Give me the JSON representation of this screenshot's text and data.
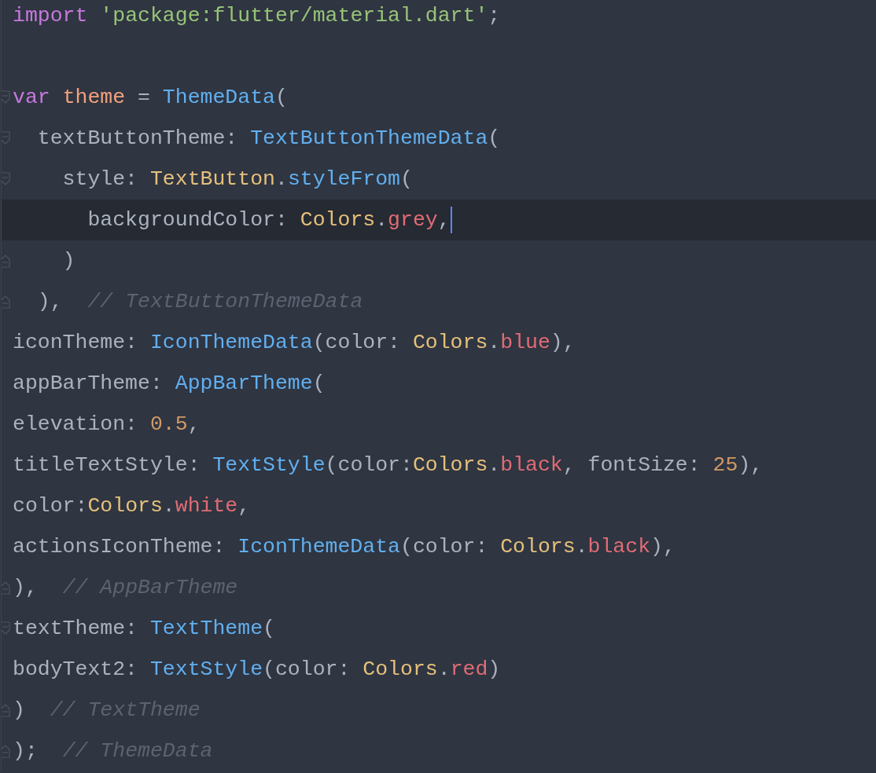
{
  "editor": {
    "lines": [
      {
        "current": false,
        "tokens": [
          {
            "kind": "keyword",
            "text": "import "
          },
          {
            "kind": "string",
            "text": "'package:flutter/material.dart'"
          },
          {
            "kind": "plain",
            "text": ";"
          }
        ]
      },
      {
        "current": false
      },
      {
        "current": false,
        "fold_opens": true,
        "tokens": [
          {
            "kind": "keyword",
            "text": "var "
          },
          {
            "kind": "variable",
            "text": "theme"
          },
          {
            "kind": "plain",
            "text": " = "
          },
          {
            "kind": "class",
            "text": "ThemeData"
          },
          {
            "kind": "plain",
            "text": "("
          }
        ]
      },
      {
        "current": false,
        "fold_opens": true,
        "tokens": [
          {
            "kind": "plain",
            "text": "  textButtonTheme: "
          },
          {
            "kind": "class",
            "text": "TextButtonThemeData"
          },
          {
            "kind": "plain",
            "text": "("
          }
        ]
      },
      {
        "current": false,
        "fold_opens": true,
        "tokens": [
          {
            "kind": "plain",
            "text": "    style: "
          },
          {
            "kind": "type",
            "text": "TextButton"
          },
          {
            "kind": "plain",
            "text": "."
          },
          {
            "kind": "class",
            "text": "styleFrom"
          },
          {
            "kind": "plain",
            "text": "("
          }
        ]
      },
      {
        "current": true,
        "caret": true,
        "tokens": [
          {
            "kind": "plain",
            "text": "      backgroundColor: "
          },
          {
            "kind": "type",
            "text": "Colors"
          },
          {
            "kind": "plain",
            "text": "."
          },
          {
            "kind": "constant",
            "text": "grey"
          },
          {
            "kind": "plain",
            "text": ","
          }
        ]
      },
      {
        "current": false,
        "fold_closes": true,
        "tokens": [
          {
            "kind": "plain",
            "text": "    )"
          }
        ]
      },
      {
        "current": false,
        "fold_closes": true,
        "tokens": [
          {
            "kind": "plain",
            "text": "  ),  "
          },
          {
            "kind": "comment",
            "text": "// TextButtonThemeData"
          }
        ]
      },
      {
        "current": false,
        "tokens": [
          {
            "kind": "plain",
            "text": "iconTheme: "
          },
          {
            "kind": "class",
            "text": "IconThemeData"
          },
          {
            "kind": "plain",
            "text": "(color: "
          },
          {
            "kind": "type",
            "text": "Colors"
          },
          {
            "kind": "plain",
            "text": "."
          },
          {
            "kind": "constant",
            "text": "blue"
          },
          {
            "kind": "plain",
            "text": "),"
          }
        ]
      },
      {
        "current": false,
        "tokens": [
          {
            "kind": "plain",
            "text": "appBarTheme: "
          },
          {
            "kind": "class",
            "text": "AppBarTheme"
          },
          {
            "kind": "plain",
            "text": "("
          }
        ]
      },
      {
        "current": false,
        "tokens": [
          {
            "kind": "plain",
            "text": "elevation: "
          },
          {
            "kind": "number",
            "text": "0.5"
          },
          {
            "kind": "plain",
            "text": ","
          }
        ]
      },
      {
        "current": false,
        "tokens": [
          {
            "kind": "plain",
            "text": "titleTextStyle: "
          },
          {
            "kind": "class",
            "text": "TextStyle"
          },
          {
            "kind": "plain",
            "text": "(color:"
          },
          {
            "kind": "type",
            "text": "Colors"
          },
          {
            "kind": "plain",
            "text": "."
          },
          {
            "kind": "constant",
            "text": "black"
          },
          {
            "kind": "plain",
            "text": ", fontSize: "
          },
          {
            "kind": "number",
            "text": "25"
          },
          {
            "kind": "plain",
            "text": "),"
          }
        ]
      },
      {
        "current": false,
        "tokens": [
          {
            "kind": "plain",
            "text": "color:"
          },
          {
            "kind": "type",
            "text": "Colors"
          },
          {
            "kind": "plain",
            "text": "."
          },
          {
            "kind": "constant",
            "text": "white"
          },
          {
            "kind": "plain",
            "text": ","
          }
        ]
      },
      {
        "current": false,
        "tokens": [
          {
            "kind": "plain",
            "text": "actionsIconTheme: "
          },
          {
            "kind": "class",
            "text": "IconThemeData"
          },
          {
            "kind": "plain",
            "text": "(color: "
          },
          {
            "kind": "type",
            "text": "Colors"
          },
          {
            "kind": "plain",
            "text": "."
          },
          {
            "kind": "constant",
            "text": "black"
          },
          {
            "kind": "plain",
            "text": "),"
          }
        ]
      },
      {
        "current": false,
        "fold_closes": true,
        "tokens": [
          {
            "kind": "plain",
            "text": "),  "
          },
          {
            "kind": "comment",
            "text": "// AppBarTheme"
          }
        ]
      },
      {
        "current": false,
        "fold_opens": true,
        "tokens": [
          {
            "kind": "plain",
            "text": "textTheme: "
          },
          {
            "kind": "class",
            "text": "TextTheme"
          },
          {
            "kind": "plain",
            "text": "("
          }
        ]
      },
      {
        "current": false,
        "tokens": [
          {
            "kind": "plain",
            "text": "bodyText2: "
          },
          {
            "kind": "class",
            "text": "TextStyle"
          },
          {
            "kind": "plain",
            "text": "(color: "
          },
          {
            "kind": "type",
            "text": "Colors"
          },
          {
            "kind": "plain",
            "text": "."
          },
          {
            "kind": "constant",
            "text": "red"
          },
          {
            "kind": "plain",
            "text": ")"
          }
        ]
      },
      {
        "current": false,
        "fold_closes": true,
        "tokens": [
          {
            "kind": "plain",
            "text": ")  "
          },
          {
            "kind": "comment",
            "text": "// TextTheme"
          }
        ]
      },
      {
        "current": false,
        "fold_closes": true,
        "tokens": [
          {
            "kind": "plain",
            "text": ");  "
          },
          {
            "kind": "comment",
            "text": "// ThemeData"
          }
        ]
      }
    ]
  }
}
